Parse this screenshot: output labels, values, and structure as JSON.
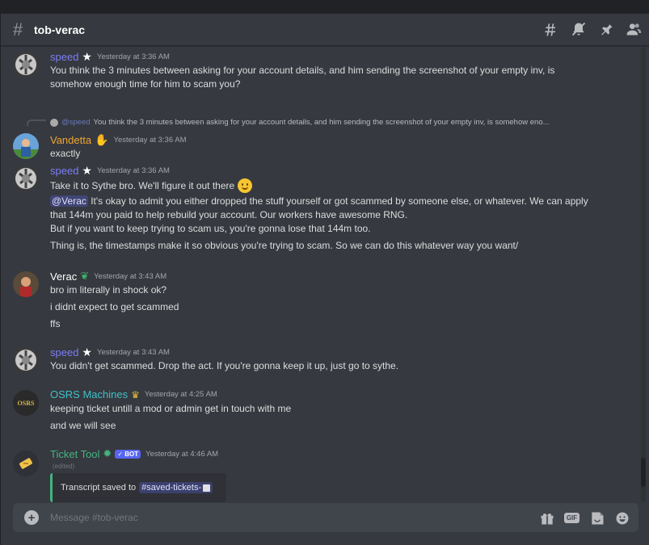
{
  "channel": {
    "name": "tob-verac"
  },
  "colors": {
    "speed": "#7b7ef6",
    "vandetta": "#f0a532",
    "verac": "#ffffff",
    "osrs": "#3ec1c9",
    "tickettool": "#43b581"
  },
  "messages": [
    {
      "author": "speed",
      "time": "Yesterday at 3:36 AM",
      "lines": [
        "You think the 3 minutes between asking for your account details, and him sending the screenshot of your empty inv, is",
        "somehow enough time for him to scam you?"
      ]
    },
    {
      "author": "Vandetta",
      "time": "Yesterday at 3:36 AM",
      "reply": {
        "name": "@speed",
        "text": "You think the 3 minutes between asking for your account details, and him sending the screenshot of your empty inv, is somehow eno..."
      },
      "lines": [
        "exactly"
      ]
    },
    {
      "author": "speed",
      "time": "Yesterday at 3:36 AM",
      "lines": [
        "Take it to Sythe bro. We'll figure it out there",
        "@Verac",
        "It's okay to admit you either dropped the stuff yourself or got scammed by someone else, or whatever. We can apply",
        "that 144m you paid to help rebuild your account. Our workers have awesome RNG.",
        "But if you want to keep trying to scam us, you're gonna lose that 144m too.",
        "Thing is, the timestamps make it so obvious you're trying to scam. So we can do this whatever way you want/"
      ]
    },
    {
      "author": "Verac",
      "time": "Yesterday at 3:43 AM",
      "lines": [
        "bro im literally in shock ok?",
        "i didnt expect to get scammed",
        "ffs"
      ]
    },
    {
      "author": "speed",
      "time": "Yesterday at 3:43 AM",
      "lines": [
        "You didn't get scammed. Drop the act. If you're gonna keep it up, just go to sythe."
      ]
    },
    {
      "author": "OSRS Machines",
      "time": "Yesterday at 4:25 AM",
      "avatar_text": "OSRS",
      "lines": [
        "keeping ticket untill a mod or admin get in touch with me",
        "and we will see"
      ]
    },
    {
      "author": "Ticket Tool",
      "time": "Yesterday at 4:46 AM",
      "bot_tag": "✓ BOT",
      "edited": "(edited)",
      "embed": {
        "text": "Transcript saved to",
        "channel": "saved-tickets-"
      }
    }
  ],
  "composer": {
    "placeholder": "Message #tob-verac",
    "gif_label": "GIF"
  },
  "icons": {
    "header": [
      "threads-icon",
      "mute-icon",
      "pin-icon",
      "members-icon"
    ],
    "composer": [
      "gift-icon",
      "gif-icon",
      "sticker-icon",
      "emoji-icon"
    ]
  }
}
